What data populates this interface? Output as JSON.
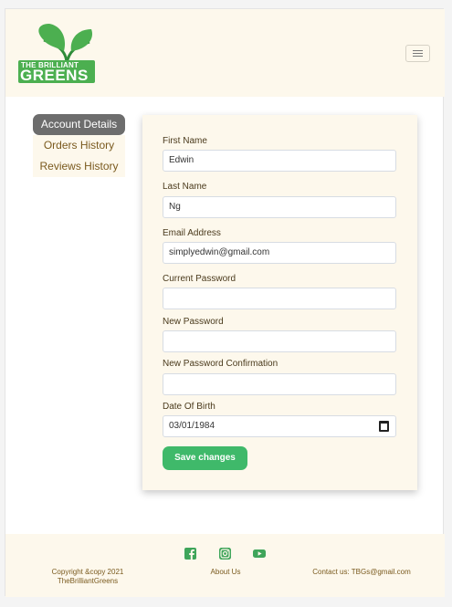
{
  "header": {
    "logo_line1": "THE BRILLIANT",
    "logo_line2": "GREENS"
  },
  "sidebar": {
    "items": [
      {
        "label": "Account Details",
        "active": true
      },
      {
        "label": "Orders History",
        "active": false
      },
      {
        "label": "Reviews History",
        "active": false
      }
    ]
  },
  "form": {
    "first_name": {
      "label": "First Name",
      "value": "Edwin"
    },
    "last_name": {
      "label": "Last Name",
      "value": "Ng"
    },
    "email": {
      "label": "Email Address",
      "value": "simplyedwin@gmail.com"
    },
    "current_password": {
      "label": "Current Password",
      "value": ""
    },
    "new_password": {
      "label": "New Password",
      "value": ""
    },
    "new_password_confirmation": {
      "label": "New Password Confirmation",
      "value": ""
    },
    "date_of_birth": {
      "label": "Date Of Birth",
      "value": "03/01/1984"
    },
    "save_label": "Save changes"
  },
  "footer": {
    "copyright": "Copyright &copy 2021 TheBrilliantGreens",
    "about": "About Us",
    "contact": "Contact us: TBGs@gmail.com",
    "social_icons": [
      "facebook-icon",
      "instagram-icon",
      "youtube-icon"
    ]
  },
  "colors": {
    "brand_green": "#4caf50",
    "button_green": "#3fb96a",
    "cream": "#fdf8ec",
    "active_tab": "#6d6d6d",
    "text_brown": "#7a5a1e"
  }
}
